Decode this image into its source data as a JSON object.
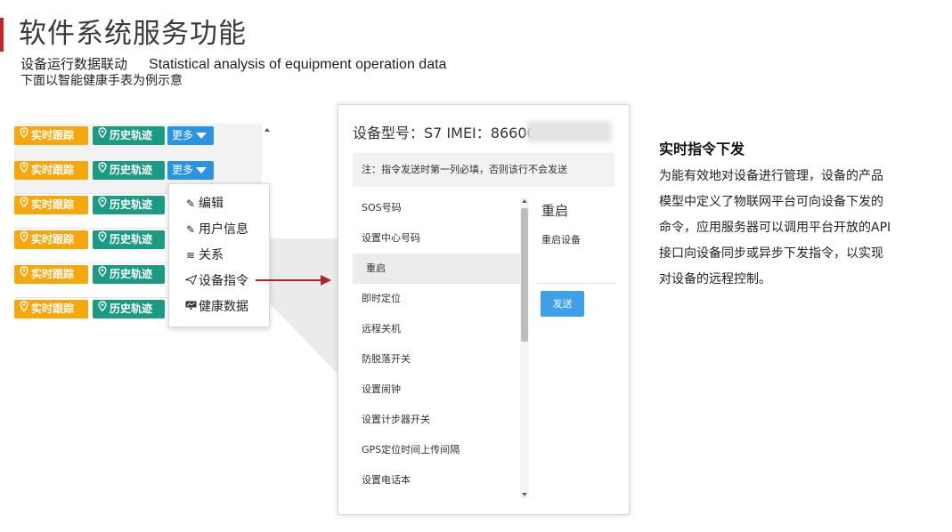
{
  "header": {
    "title": "软件系统服务功能",
    "subtitle_cn": "设备运行数据联动",
    "subtitle_en": "Statistical analysis of equipment operation data",
    "subtitle2": "下面以智能健康手表为例示意",
    "accent_color": "#c0282d"
  },
  "table": {
    "realtime_label": "实时跟踪",
    "history_label": "历史轨迹",
    "more_label": "更多",
    "row_count_visible": 6,
    "colors": {
      "realtime": "#f5a70c",
      "history": "#1b9b84",
      "more": "#2c93df"
    }
  },
  "dropdown": {
    "items": [
      {
        "label": "编辑",
        "icon": "pencil-icon"
      },
      {
        "label": "用户信息",
        "icon": "pencil-icon"
      },
      {
        "label": "关系",
        "icon": "layers-icon"
      },
      {
        "label": "设备指令",
        "icon": "paper-plane-icon"
      },
      {
        "label": "健康数据",
        "icon": "chart-icon"
      }
    ]
  },
  "panel": {
    "device_title": "设备型号：S7 IMEI：86600",
    "notice": "注：指令发送时第一列必填，否则该行不会发送",
    "commands": [
      "SOS号码",
      "设置中心号码",
      "重启",
      "即时定位",
      "远程关机",
      "防脱落开关",
      "设置闹钟",
      "设置计步器开关",
      "GPS定位时间上传间隔",
      "设置电话本"
    ],
    "active_command": "重启",
    "detail_title": "重启",
    "detail_text": "重启设备",
    "send_label": "发送"
  },
  "right": {
    "heading": "实时指令下发",
    "lines": [
      "为能有效地对设备进行管理，设备的产品",
      "模型中定义了物联网平台可向设备下发的",
      "命令，应用服务器可以调用平台开放的API",
      "接口向设备同步或异步下发指令，以实现",
      "对设备的远程控制。"
    ]
  }
}
